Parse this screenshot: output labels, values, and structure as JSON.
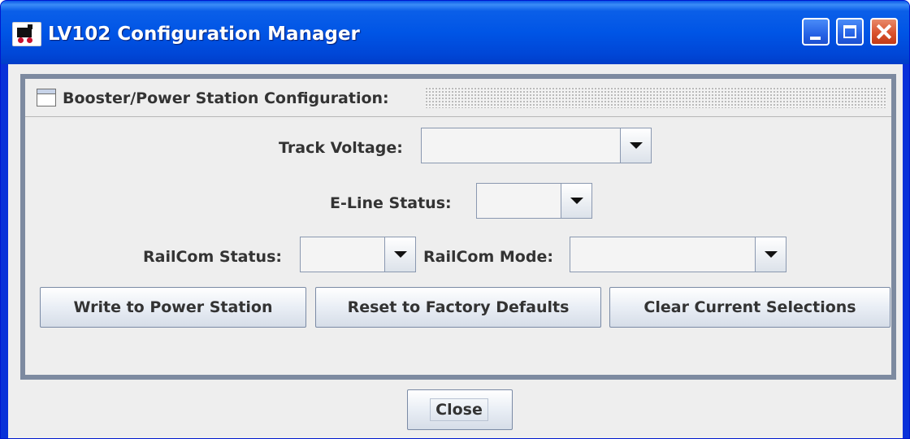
{
  "window": {
    "title": "LV102 Configuration Manager",
    "icon": "train-icon",
    "controls": [
      "minimize-icon",
      "maximize-icon",
      "close-icon"
    ]
  },
  "panel": {
    "title": "Booster/Power Station Configuration:",
    "icon": "window-icon"
  },
  "fields": {
    "track_voltage": {
      "label": "Track Voltage:",
      "value": ""
    },
    "eline_status": {
      "label": "E-Line Status:",
      "value": ""
    },
    "railcom_status": {
      "label": "RailCom Status:",
      "value": ""
    },
    "railcom_mode": {
      "label": "RailCom Mode:",
      "value": ""
    }
  },
  "buttons": {
    "write": "Write to Power Station",
    "reset": "Reset to Factory Defaults",
    "clear": "Clear Current Selections",
    "close": "Close"
  }
}
